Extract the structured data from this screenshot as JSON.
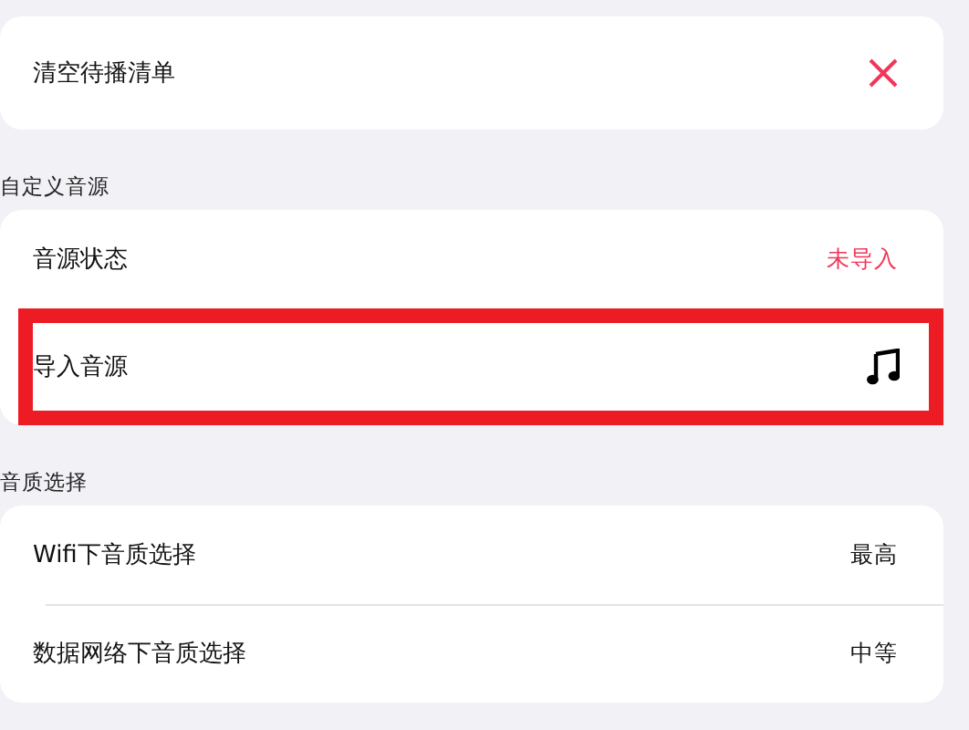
{
  "sections": [
    {
      "rows": [
        {
          "kind": "close",
          "label": "清空待播清单",
          "highlighted": false
        }
      ]
    },
    {
      "title": "自定义音源",
      "rows": [
        {
          "kind": "value",
          "label": "音源状态",
          "value": "未导入",
          "alert": true,
          "highlighted": false
        },
        {
          "kind": "music",
          "label": "导入音源",
          "highlighted": true
        }
      ]
    },
    {
      "title": "音质选择",
      "rows": [
        {
          "kind": "value",
          "label": "Wifi下音质选择",
          "value": "最高",
          "alert": false,
          "highlighted": false
        },
        {
          "kind": "value",
          "label": "数据网络下音质选择",
          "value": "中等",
          "alert": false,
          "highlighted": false
        }
      ]
    }
  ]
}
